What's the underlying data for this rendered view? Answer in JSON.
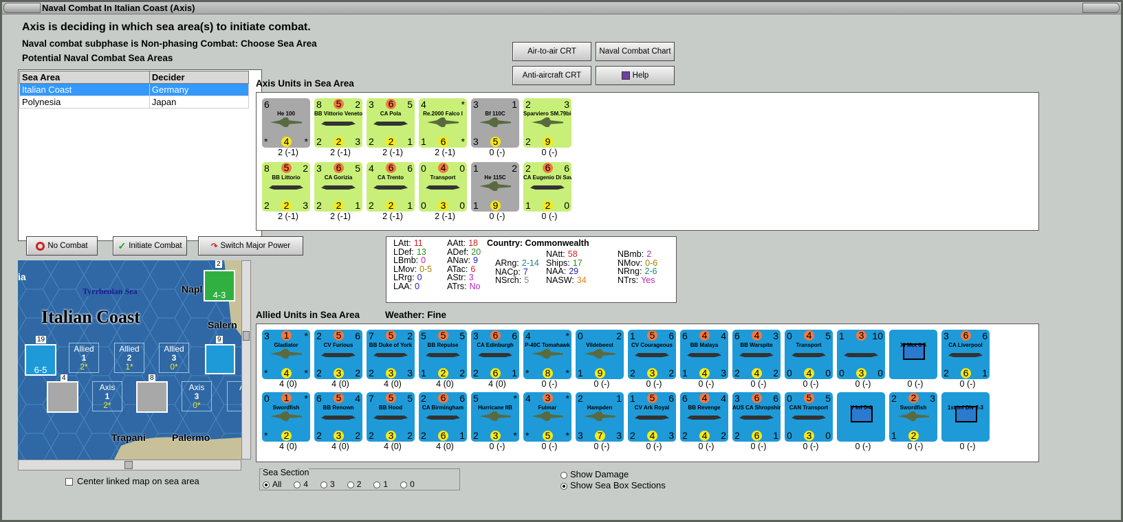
{
  "window": {
    "title": "Naval Combat In Italian Coast (Axis)"
  },
  "header": {
    "line1": "Axis is deciding in which sea area(s) to initiate combat.",
    "line2": "Naval combat subphase is Non-phasing Combat: Choose Sea Area",
    "line3": "Potential Naval Combat Sea Areas"
  },
  "table": {
    "columns": [
      "Sea Area",
      "Decider"
    ],
    "rows": [
      [
        "Italian Coast",
        "Germany"
      ],
      [
        "Polynesia",
        "Japan"
      ]
    ]
  },
  "buttons": {
    "air_crt": "Air-to-air CRT",
    "naval_chart": "Naval Combat Chart",
    "aa_crt": "Anti-aircraft CRT",
    "help": "Help",
    "no_combat": "No Combat",
    "initiate": "Initiate Combat",
    "switch": "Switch Major Power"
  },
  "axis": {
    "title": "Axis Units in Sea Area",
    "units": [
      {
        "name": "He 100",
        "tl": "6",
        "tr": "",
        "tm": "",
        "bl": "*",
        "bm": "4",
        "br": "*",
        "cap": "2 (-1)",
        "color": "grey",
        "kind": "plane"
      },
      {
        "name": "BB Vittorio Veneto",
        "tl": "8",
        "tr": "2",
        "tm": "5",
        "bl": "2",
        "bm": "2",
        "br": "3",
        "cap": "2 (-1)",
        "color": "green",
        "kind": "ship"
      },
      {
        "name": "CA Pola",
        "tl": "3",
        "tr": "5",
        "tm": "6",
        "bl": "2",
        "bm": "2",
        "br": "1",
        "cap": "2 (-1)",
        "color": "green",
        "kind": "ship"
      },
      {
        "name": "Re.2000 Falco I",
        "tl": "4",
        "tr": "*",
        "tm": "",
        "bl": "1",
        "bm": "6",
        "br": "*",
        "cap": "2 (-1)",
        "color": "green",
        "kind": "plane"
      },
      {
        "name": "Bf 110C",
        "tl": "3",
        "tr": "1",
        "tm": "",
        "bl": "3",
        "bm": "5",
        "br": "",
        "cap": "0 (-)",
        "color": "grey",
        "kind": "plane"
      },
      {
        "name": "Sparviero SM.79bis",
        "tl": "2",
        "tr": "3",
        "tm": "",
        "bl": "2",
        "bm": "9",
        "br": "",
        "cap": "0 (-)",
        "color": "green",
        "kind": "plane"
      },
      {
        "name": "BB Littorio",
        "tl": "8",
        "tr": "2",
        "tm": "5",
        "bl": "2",
        "bm": "2",
        "br": "3",
        "cap": "2 (-1)",
        "color": "green",
        "kind": "ship"
      },
      {
        "name": "CA Gorizia",
        "tl": "3",
        "tr": "5",
        "tm": "6",
        "bl": "2",
        "bm": "2",
        "br": "1",
        "cap": "2 (-1)",
        "color": "green",
        "kind": "ship"
      },
      {
        "name": "CA Trento",
        "tl": "4",
        "tr": "6",
        "tm": "6",
        "bl": "2",
        "bm": "2",
        "br": "1",
        "cap": "2 (-1)",
        "color": "green",
        "kind": "ship"
      },
      {
        "name": "Transport",
        "tl": "0",
        "tr": "0",
        "tm": "4",
        "bl": "0",
        "bm": "3",
        "br": "0",
        "cap": "2 (-1)",
        "color": "green",
        "kind": "ship"
      },
      {
        "name": "He 115C",
        "tl": "1",
        "tr": "2",
        "tm": "",
        "bl": "1",
        "bm": "9",
        "br": "",
        "cap": "0 (-)",
        "color": "grey",
        "kind": "plane"
      },
      {
        "name": "CA Eugenio Di Savoia",
        "tl": "2",
        "tr": "6",
        "tm": "6",
        "bl": "1",
        "bm": "2",
        "br": "0",
        "cap": "0 (-)",
        "color": "green",
        "kind": "ship"
      }
    ]
  },
  "stats": {
    "country_label": "Country: Commonwealth",
    "col1": [
      [
        "LAtt:",
        "11",
        "#d02020"
      ],
      [
        "LDef:",
        "13",
        "#209020"
      ],
      [
        "LBmb:",
        "0",
        "#c020c0"
      ],
      [
        "LMov:",
        "0-5",
        "#a08000"
      ],
      [
        "LRrg:",
        "0",
        "#2020c0"
      ],
      [
        "LAA:",
        "0",
        "#2020c0"
      ]
    ],
    "col2": [
      [
        "AAtt:",
        "18",
        "#d02020"
      ],
      [
        "ADef:",
        "20",
        "#209020"
      ],
      [
        "ANav:",
        "9",
        "#2020c0"
      ],
      [
        "ATac:",
        "6",
        "#d02020"
      ],
      [
        "AStr:",
        "3",
        "#c020c0"
      ],
      [
        "ATrs:",
        "No",
        "#c020c0"
      ]
    ],
    "col3": [
      [
        "ARng:",
        "2-14",
        "#208080"
      ],
      [
        "NACp:",
        "7",
        "#2020c0"
      ],
      [
        "NSrch:",
        "5",
        "#808080"
      ]
    ],
    "col4": [
      [
        "NAtt:",
        "58",
        "#d02020"
      ],
      [
        "Ships:",
        "17",
        "#209020"
      ],
      [
        "NAA:",
        "29",
        "#2020c0"
      ],
      [
        "NASW:",
        "34",
        "#e08020"
      ]
    ],
    "col5": [
      [
        "NBmb:",
        "2",
        "#c020c0"
      ],
      [
        "NMov:",
        "0-6",
        "#a08000"
      ],
      [
        "NRng:",
        "2-6",
        "#208080"
      ],
      [
        "NTrs:",
        "Yes",
        "#c020c0"
      ]
    ]
  },
  "allied": {
    "title": "Allied Units in Sea Area",
    "weather": "Weather:  Fine",
    "units": [
      {
        "name": "Gladiator",
        "tl": "3",
        "tr": "*",
        "tm": "1",
        "bl": "*",
        "bm": "4",
        "br": "*",
        "cap": "4 (0)",
        "kind": "plane"
      },
      {
        "name": "CV Furious",
        "tl": "2",
        "tr": "6",
        "tm": "5",
        "bl": "2",
        "bm": "3",
        "br": "2",
        "cap": "4 (0)",
        "kind": "ship"
      },
      {
        "name": "BB Duke of York",
        "tl": "7",
        "tr": "2",
        "tm": "5",
        "bl": "2",
        "bm": "3",
        "br": "3",
        "cap": "4 (0)",
        "kind": "ship"
      },
      {
        "name": "BB Repulse",
        "tl": "5",
        "tr": "5",
        "tm": "5",
        "bl": "1",
        "bm": "2",
        "br": "2",
        "cap": "4 (0)",
        "kind": "ship"
      },
      {
        "name": "CA Edinburgh",
        "tl": "3",
        "tr": "6",
        "tm": "6",
        "bl": "2",
        "bm": "6",
        "br": "1",
        "cap": "4 (0)",
        "kind": "ship"
      },
      {
        "name": "P-40C Tomahawk",
        "tl": "4",
        "tr": "*",
        "tm": "",
        "bl": "*",
        "bm": "8",
        "br": "*",
        "cap": "0 (-)",
        "kind": "plane"
      },
      {
        "name": "Vildebeest",
        "tl": "0",
        "tr": "2",
        "tm": "",
        "bl": "1",
        "bm": "9",
        "br": "",
        "cap": "0 (-)",
        "kind": "plane"
      },
      {
        "name": "CV Courageous",
        "tl": "1",
        "tr": "6",
        "tm": "5",
        "bl": "2",
        "bm": "3",
        "br": "2",
        "cap": "0 (-)",
        "kind": "ship"
      },
      {
        "name": "BB Malaya",
        "tl": "6",
        "tr": "4",
        "tm": "4",
        "bl": "1",
        "bm": "4",
        "br": "3",
        "cap": "0 (-)",
        "kind": "ship"
      },
      {
        "name": "BB Warspite",
        "tl": "6",
        "tr": "3",
        "tm": "4",
        "bl": "2",
        "bm": "4",
        "br": "2",
        "cap": "0 (-)",
        "kind": "ship"
      },
      {
        "name": "Transport",
        "tl": "0",
        "tr": "5",
        "tm": "4",
        "bl": "0",
        "bm": "4",
        "br": "0",
        "cap": "0 (-)",
        "kind": "ship"
      },
      {
        "name": "",
        "tl": "1",
        "tr": "10",
        "tm": "3",
        "bl": "0",
        "bm": "3",
        "br": "0",
        "cap": "0 (-)",
        "kind": "ship"
      },
      {
        "name": "XI Mot 6-5",
        "tl": "",
        "tr": "",
        "tm": "",
        "bl": "",
        "bm": "",
        "br": "",
        "cap": "0 (-)",
        "kind": "army"
      },
      {
        "name": "CA Liverpool",
        "tl": "3",
        "tr": "6",
        "tm": "6",
        "bl": "2",
        "bm": "6",
        "br": "1",
        "cap": "0 (-)",
        "kind": "ship"
      },
      {
        "name": "Swordfish",
        "tl": "0",
        "tr": "*",
        "tm": "1",
        "bl": "*",
        "bm": "2",
        "br": "",
        "cap": "4 (0)",
        "kind": "plane"
      },
      {
        "name": "BB Renown",
        "tl": "6",
        "tr": "4",
        "tm": "5",
        "bl": "2",
        "bm": "3",
        "br": "2",
        "cap": "4 (0)",
        "kind": "ship"
      },
      {
        "name": "BB Hood",
        "tl": "7",
        "tr": "5",
        "tm": "5",
        "bl": "2",
        "bm": "3",
        "br": "2",
        "cap": "4 (0)",
        "kind": "ship"
      },
      {
        "name": "CA Birmingham",
        "tl": "2",
        "tr": "6",
        "tm": "6",
        "bl": "2",
        "bm": "6",
        "br": "1",
        "cap": "4 (0)",
        "kind": "ship"
      },
      {
        "name": "Hurricane IIB",
        "tl": "5",
        "tr": "*",
        "tm": "",
        "bl": "2",
        "bm": "3",
        "br": "*",
        "cap": "0 (-)",
        "kind": "plane"
      },
      {
        "name": "Fulmar",
        "tl": "4",
        "tr": "*",
        "tm": "3",
        "bl": "*",
        "bm": "5",
        "br": "*",
        "cap": "0 (-)",
        "kind": "plane"
      },
      {
        "name": "Hampden",
        "tl": "2",
        "tr": "1",
        "tm": "",
        "bl": "3",
        "bm": "7",
        "br": "3",
        "cap": "0 (-)",
        "kind": "plane"
      },
      {
        "name": "CV Ark Royal",
        "tl": "1",
        "tr": "6",
        "tm": "5",
        "bl": "2",
        "bm": "4",
        "br": "3",
        "cap": "0 (-)",
        "kind": "ship"
      },
      {
        "name": "BB Revenge",
        "tl": "6",
        "tr": "4",
        "tm": "4",
        "bl": "2",
        "bm": "4",
        "br": "2",
        "cap": "0 (-)",
        "kind": "ship"
      },
      {
        "name": "AUS CA Shropshire",
        "tl": "3",
        "tr": "6",
        "tm": "6",
        "bl": "2",
        "bm": "6",
        "br": "1",
        "cap": "0 (-)",
        "kind": "ship"
      },
      {
        "name": "CAN Transport",
        "tl": "0",
        "tr": "5",
        "tm": "5",
        "bl": "0",
        "bm": "3",
        "br": "0",
        "cap": "0 (-)",
        "kind": "ship"
      },
      {
        "name": "V Inf 5-4",
        "tl": "",
        "tr": "",
        "tm": "",
        "bl": "",
        "bm": "",
        "br": "",
        "cap": "0 (-)",
        "kind": "army"
      },
      {
        "name": "Swordfish",
        "tl": "2",
        "tr": "3",
        "tm": "2",
        "bl": "1",
        "bm": "2",
        "br": "",
        "cap": "0 (-)",
        "kind": "plane"
      },
      {
        "name": "1st Inf Div 2-3",
        "tl": "",
        "tr": "",
        "tm": "",
        "bl": "",
        "bm": "",
        "br": "",
        "cap": "0 (-)",
        "kind": "army"
      }
    ]
  },
  "map": {
    "title": "Italian Coast",
    "sea_label": "Tyrrhenian Sea",
    "city1": "Napl",
    "city2": "Salern",
    "city3": "Trapani",
    "city4": "Palermo",
    "ia": "ia",
    "boxes": [
      "Allied",
      "Allied",
      "Allied",
      "Axis",
      "Axis",
      "A"
    ],
    "box_nums": [
      "1",
      "2",
      "3",
      "1",
      "3"
    ],
    "box_vals": [
      "2*",
      "1*",
      "0*",
      "2*",
      "0*"
    ],
    "counter_top": "4-3",
    "counter_left": "6-5",
    "n19": "19",
    "n9": "9",
    "n4": "4",
    "n8": "8",
    "n2": "2"
  },
  "footer": {
    "center_linked": "Center linked map on sea area",
    "sea_section": "Sea Section",
    "sections": [
      "All",
      "4",
      "3",
      "2",
      "1",
      "0"
    ],
    "show_damage": "Show Damage",
    "show_boxes": "Show Sea Box Sections"
  }
}
